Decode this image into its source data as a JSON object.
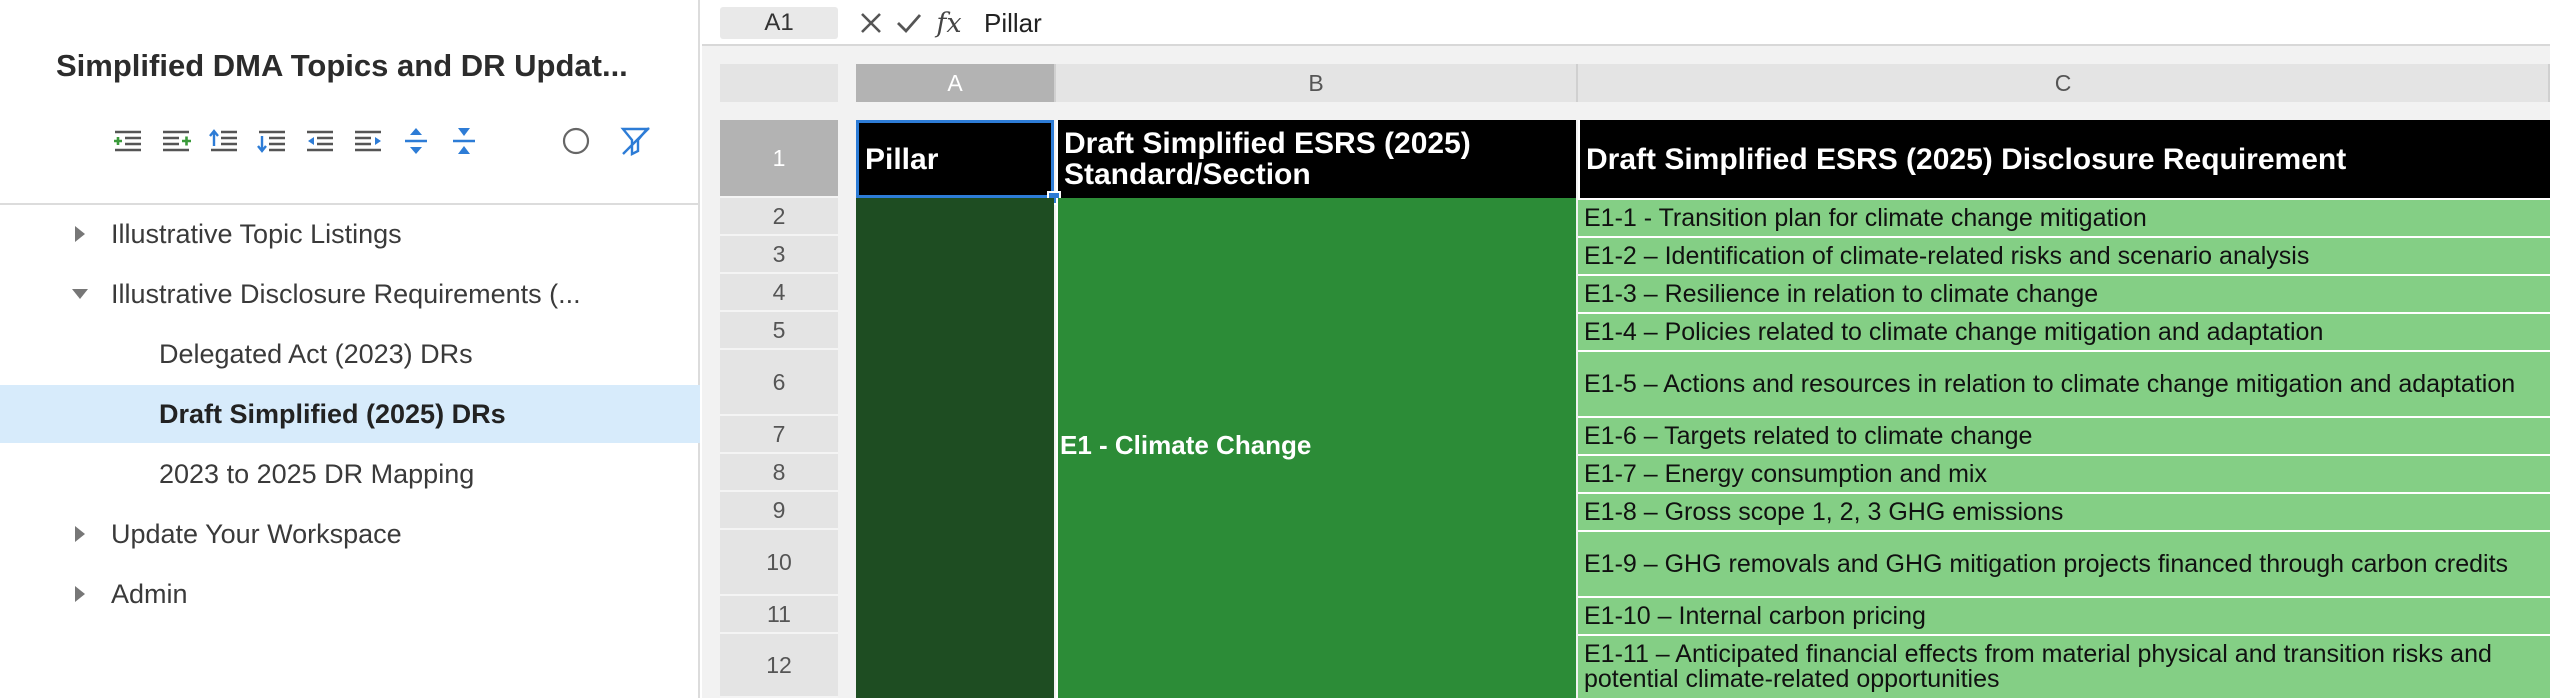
{
  "sidebar": {
    "title": "Simplified DMA Topics and DR Updat...",
    "toolbar_icons": [
      "indent-add-icon",
      "outdent-add-icon",
      "move-up-icon",
      "move-down-icon",
      "outdent-icon",
      "indent-icon",
      "expand-all-icon",
      "collapse-all-icon",
      "circle-icon",
      "filter-clear-icon"
    ],
    "tree": [
      {
        "label": "Illustrative Topic Listings",
        "state": "collapsed",
        "level": 0
      },
      {
        "label": "Illustrative Disclosure Requirements (...",
        "state": "expanded",
        "level": 0
      },
      {
        "label": "Delegated Act (2023) DRs",
        "state": "leaf",
        "level": 1
      },
      {
        "label": "Draft Simplified (2025) DRs",
        "state": "leaf",
        "level": 1,
        "selected": true
      },
      {
        "label": "2023 to 2025 DR Mapping",
        "state": "leaf",
        "level": 1
      },
      {
        "label": "Update Your Workspace",
        "state": "collapsed",
        "level": 0
      },
      {
        "label": "Admin",
        "state": "collapsed",
        "level": 0
      }
    ]
  },
  "formula_bar": {
    "name_box": "A1",
    "fx": "fx",
    "value": "Pillar"
  },
  "columns": [
    "A",
    "B",
    "C"
  ],
  "rows": [
    "1",
    "2",
    "3",
    "4",
    "5",
    "6",
    "7",
    "8",
    "9",
    "10",
    "11",
    "12"
  ],
  "header": {
    "pillar": "Pillar",
    "standard": "Draft Simplified  ESRS (2025) Standard/Section",
    "requirement": "Draft Simplified  ESRS (2025)  Disclosure Requirement"
  },
  "standard_value": "E1 - Climate Change",
  "requirements": [
    "E1-1 - Transition plan for climate change mitigation",
    "E1-2 – Identification of climate-related risks and scenario analysis",
    "E1-3 – Resilience in relation to climate change",
    "E1-4 – Policies related to climate change mitigation and adaptation",
    "E1-5 – Actions and resources in relation to climate change mitigation and adaptation",
    "E1-6 – Targets related to climate change",
    "E1-7 – Energy consumption and mix",
    "E1-8 – Gross scope 1, 2, 3 GHG emissions",
    "E1-9 – GHG removals and GHG mitigation projects financed through carbon credits",
    "E1-10 – Internal carbon pricing",
    "E1-11 – Anticipated financial effects from material physical and transition risks and potential climate-related opportunities"
  ],
  "colors": {
    "header_bg": "#000000",
    "pillar_bg": "#1e4d22",
    "standard_bg": "#2c8c37",
    "requirement_bg": "#84cf85",
    "selection": "#2d7cd6",
    "tree_selected": "#d7ebfb"
  }
}
